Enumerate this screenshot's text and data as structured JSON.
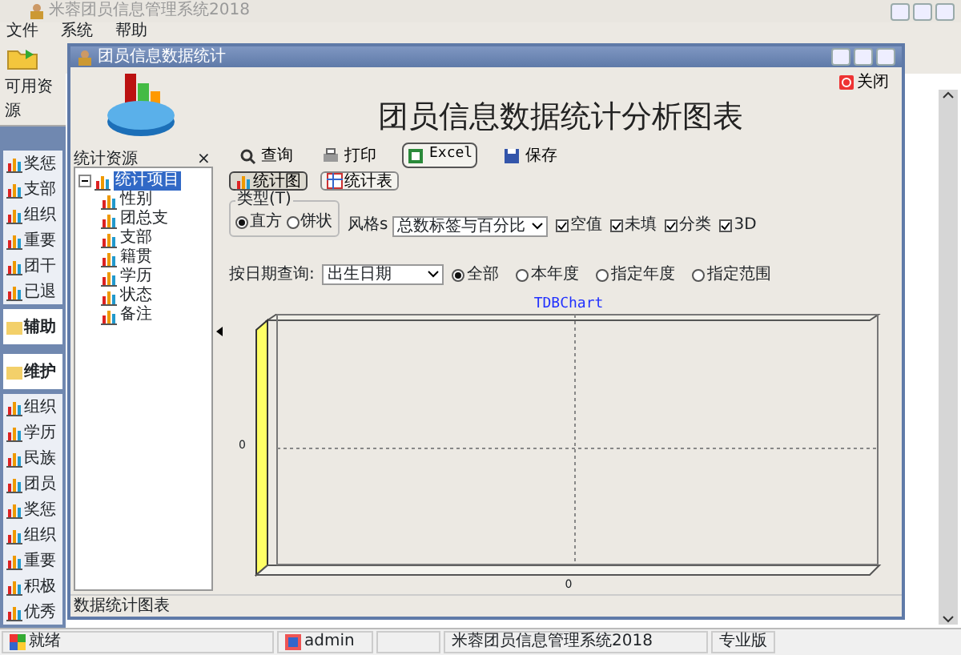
{
  "window": {
    "title": "米蓉团员信息管理系统2018"
  },
  "menu": [
    "文件",
    "系统",
    "帮助"
  ],
  "sidebar": {
    "title": "可用资源",
    "items": [
      {
        "label": "奖惩",
        "kind": "item"
      },
      {
        "label": "支部",
        "kind": "item"
      },
      {
        "label": "组织",
        "kind": "item"
      },
      {
        "label": "重要",
        "kind": "item"
      },
      {
        "label": "团干",
        "kind": "item"
      },
      {
        "label": "已退",
        "kind": "item"
      },
      {
        "label": "辅助",
        "kind": "group"
      },
      {
        "label": "维护",
        "kind": "group"
      },
      {
        "label": "组织",
        "kind": "item"
      },
      {
        "label": "学历",
        "kind": "item"
      },
      {
        "label": "民族",
        "kind": "item"
      },
      {
        "label": "团员",
        "kind": "item"
      },
      {
        "label": "奖惩",
        "kind": "item"
      },
      {
        "label": "组织",
        "kind": "item"
      },
      {
        "label": "重要",
        "kind": "item"
      },
      {
        "label": "积极",
        "kind": "item"
      },
      {
        "label": "优秀",
        "kind": "item"
      }
    ]
  },
  "child_window": {
    "title": "团员信息数据统计",
    "close_label": "关闭",
    "heading": "团员信息数据统计分析图表",
    "toolbar": [
      "查询",
      "打印",
      "Excel",
      "保存"
    ],
    "tree": {
      "title": "统计资源",
      "close": "×",
      "items": [
        {
          "label": "统计项目",
          "selected": true,
          "expanded": true,
          "children": [
            {
              "label": "性别",
              "selected": false
            },
            {
              "label": "团总支",
              "selected": false
            },
            {
              "label": "支部",
              "selected": false
            },
            {
              "label": "籍贯",
              "selected": false
            },
            {
              "label": "学历",
              "selected": false
            },
            {
              "label": "状态",
              "selected": false
            },
            {
              "label": "备注",
              "selected": false
            }
          ]
        }
      ]
    },
    "view_buttons": [
      {
        "label": "统计图",
        "selected": true
      },
      {
        "label": "统计表",
        "selected": false
      }
    ],
    "chart_type": {
      "title": "类型(T)",
      "options": [
        {
          "label": "直方",
          "selected": true
        },
        {
          "label": "饼状",
          "selected": false
        }
      ]
    },
    "style": {
      "label": "风格s",
      "value": "总数标签与百分比"
    },
    "options": [
      {
        "label": "空值",
        "checked": true
      },
      {
        "label": "未填",
        "checked": true
      },
      {
        "label": "分类",
        "checked": true
      },
      {
        "label": "3D",
        "checked": true
      }
    ],
    "date_query": {
      "label": "按日期查询:",
      "value": "出生日期",
      "options": [
        {
          "label": "全部",
          "selected": true
        },
        {
          "label": "本年度",
          "selected": false
        },
        {
          "label": "指定年度",
          "selected": false
        },
        {
          "label": "指定范围",
          "selected": false
        }
      ]
    },
    "chart": {
      "title": "TDBChart",
      "y_label": "0",
      "x_label": "0"
    },
    "status": "数据统计图表"
  },
  "status_bar": {
    "items": [
      "就绪",
      "admin",
      "米蓉团员信息管理系统2018",
      "专业版"
    ]
  }
}
